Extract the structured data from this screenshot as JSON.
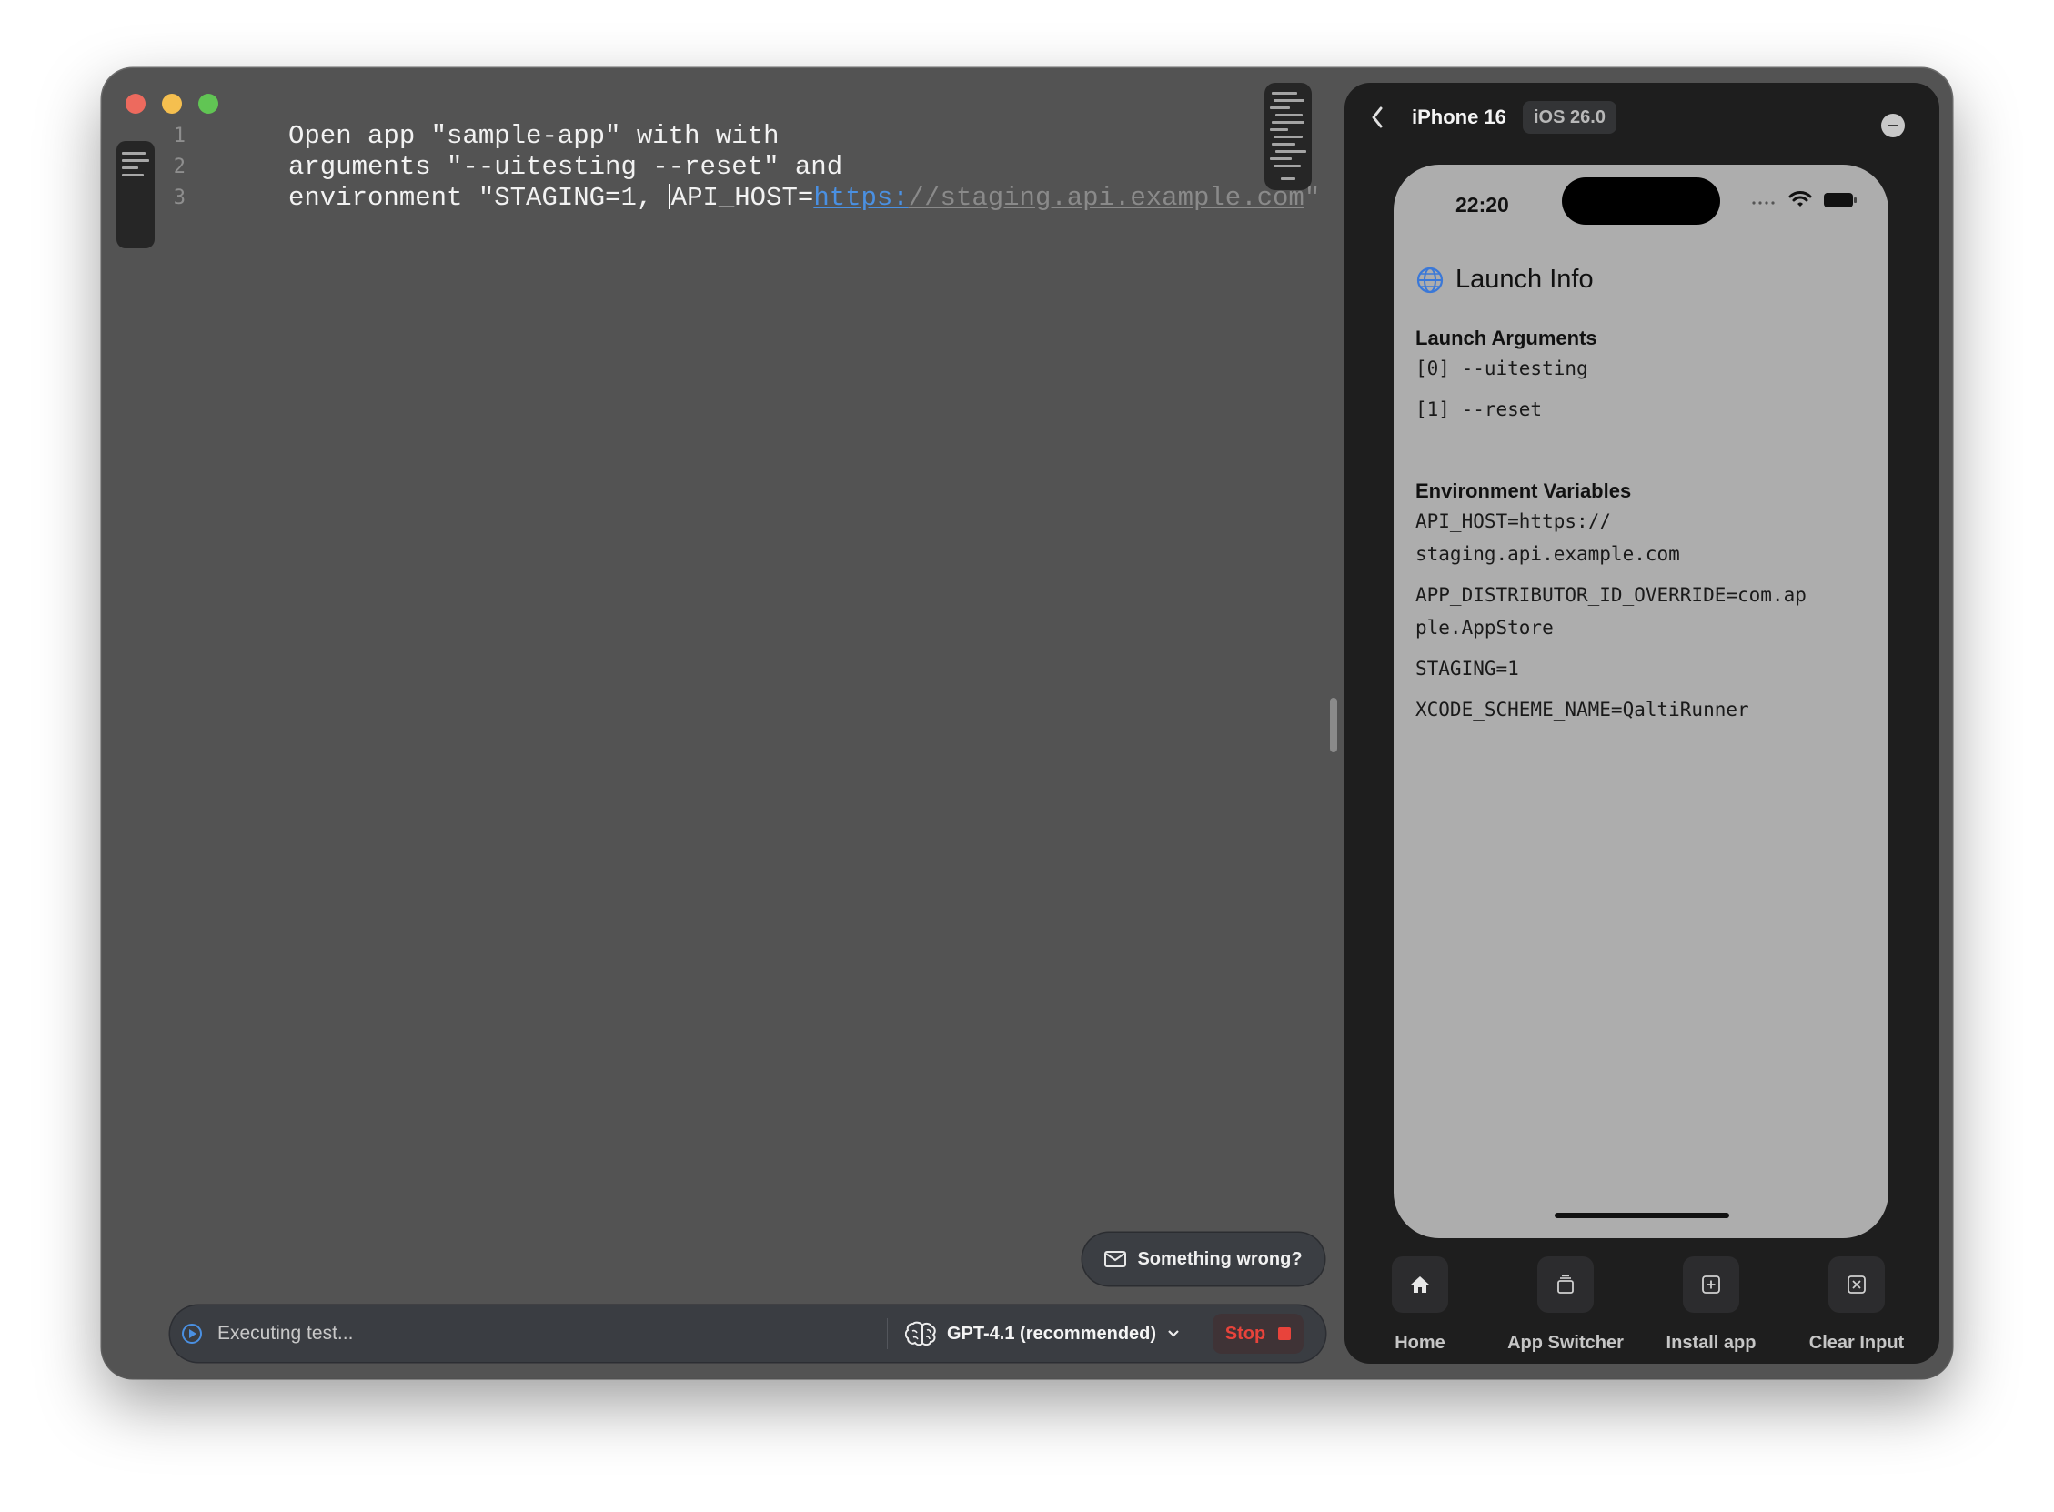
{
  "editor": {
    "line_numbers": [
      "1",
      "2",
      "3"
    ],
    "lines": {
      "l1": "Open app \"sample-app\" with with",
      "l2": "arguments \"--uitesting --reset\" and",
      "l3_a": "environment \"STAGING=1, ",
      "l3_b": "API_HOST=",
      "l3_url_scheme": "https:",
      "l3_url_rest": "//staging.api.example.com",
      "l3_end": "\""
    }
  },
  "feedback": {
    "label": "Something wrong?"
  },
  "bottom_bar": {
    "status": "Executing test...",
    "model": "GPT-4.1 (recommended)",
    "stop_label": "Stop"
  },
  "simulator": {
    "device_name": "iPhone 16",
    "os_version": "iOS 26.0",
    "phone": {
      "time": "22:20",
      "title": "Launch Info",
      "args_heading": "Launch Arguments",
      "args": [
        "[0] --uitesting",
        "[1] --reset"
      ],
      "env_heading": "Environment Variables",
      "env": [
        "API_HOST=https://\nstaging.api.example.com",
        "APP_DISTRIBUTOR_ID_OVERRIDE=com.ap\nple.AppStore",
        "STAGING=1",
        "XCODE_SCHEME_NAME=QaltiRunner"
      ]
    },
    "tools": [
      {
        "label": "Home",
        "icon": "house-icon"
      },
      {
        "label": "App Switcher",
        "icon": "app-switcher-icon"
      },
      {
        "label": "Install app",
        "icon": "install-app-icon"
      },
      {
        "label": "Clear Input",
        "icon": "clear-input-icon"
      }
    ]
  },
  "colors": {
    "editor_bg": "#535353",
    "panel_bg": "#1e1e1e",
    "phone_screen": "#adadad",
    "link": "#4a90e2",
    "stop": "#e8433b"
  }
}
